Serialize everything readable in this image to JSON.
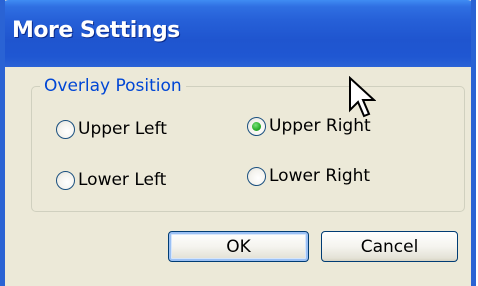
{
  "window": {
    "title": "More Settings"
  },
  "group": {
    "legend": "Overlay Position"
  },
  "radios": {
    "upper_left": {
      "label": "Upper Left",
      "selected": false
    },
    "upper_right": {
      "label": "Upper Right",
      "selected": true
    },
    "lower_left": {
      "label": "Lower Left",
      "selected": false
    },
    "lower_right": {
      "label": "Lower Right",
      "selected": false
    }
  },
  "buttons": {
    "ok": "OK",
    "cancel": "Cancel"
  },
  "icons": {
    "cursor": "mouse-pointer-icon"
  },
  "colors": {
    "titlebar": "#2660d8",
    "dialog_background": "#ece9d8",
    "group_legend": "#0046d5",
    "radio_selected_dot": "#2fb32f"
  }
}
